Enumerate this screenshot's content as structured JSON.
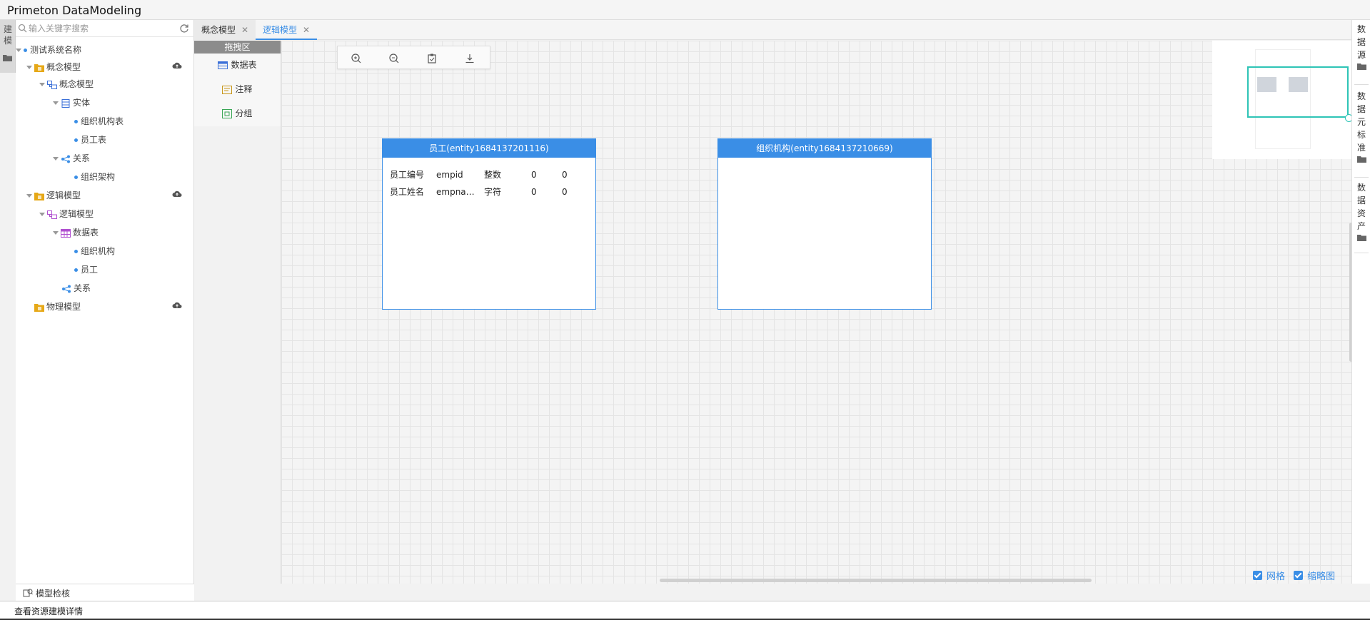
{
  "app": {
    "title": "Primeton DataModeling"
  },
  "left_tab": {
    "label": "建模"
  },
  "search": {
    "placeholder": "输入关键字搜索"
  },
  "tree": {
    "root": "测试系统名称",
    "concept_model": "概念模型",
    "concept_model_child": "概念模型",
    "entity": "实体",
    "org_table": "组织机构表",
    "employee_table": "员工表",
    "relation": "关系",
    "org_structure": "组织架构",
    "logical_model": "逻辑模型",
    "logical_model_child": "逻辑模型",
    "data_table": "数据表",
    "org": "组织机构",
    "employee": "员工",
    "logical_relation": "关系",
    "physical_model": "物理模型"
  },
  "bottom": {
    "model_check": "模型检核",
    "status": "查看资源建模详情"
  },
  "tabs": [
    {
      "label": "概念模型"
    },
    {
      "label": "逻辑模型"
    }
  ],
  "palette": {
    "title": "拖拽区",
    "items": [
      "数据表",
      "注释",
      "分组"
    ]
  },
  "entities": [
    {
      "title": "员工(entity1684137201116)",
      "fields": [
        {
          "name": "员工编号",
          "code": "empid",
          "type": "整数",
          "length": "0",
          "precision": "0"
        },
        {
          "name": "员工姓名",
          "code": "empna…",
          "type": "字符",
          "length": "0",
          "precision": "0"
        }
      ]
    },
    {
      "title": "组织机构(entity1684137210669)",
      "fields": []
    }
  ],
  "right_panel": {
    "groups": [
      "数据源",
      "数据元标准",
      "数据资产"
    ]
  },
  "view_options": {
    "grid": "网格",
    "thumbnail": "缩略图",
    "grid_checked": true,
    "thumbnail_checked": true
  },
  "colors": {
    "accent": "#3a8ee6",
    "minimap_frame": "#2ec4b6"
  }
}
